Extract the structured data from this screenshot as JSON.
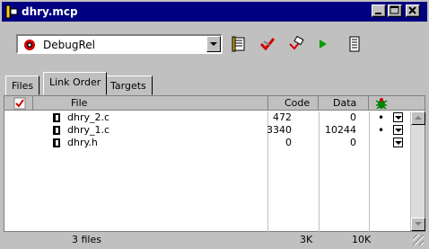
{
  "window": {
    "title": "dhry.mcp"
  },
  "toolbar": {
    "target": "DebugRel",
    "buttons": [
      "make-icon",
      "check-icon",
      "check-edit-icon",
      "run-icon",
      "settings-icon"
    ]
  },
  "tabs": [
    {
      "label": "Files",
      "active": false
    },
    {
      "label": "Link Order",
      "active": true
    },
    {
      "label": "Targets",
      "active": false
    }
  ],
  "table": {
    "headers": {
      "file": "File",
      "code": "Code",
      "data": "Data"
    },
    "rows": [
      {
        "name": "dhry_2.c",
        "code": "472",
        "data": "0",
        "dot": "•"
      },
      {
        "name": "dhry_1.c",
        "code": "3340",
        "data": "10244",
        "dot": "•"
      },
      {
        "name": "dhry.h",
        "code": "0",
        "data": "0",
        "dot": ""
      }
    ]
  },
  "status": {
    "files": "3 files",
    "code_total": "3K",
    "data_total": "10K"
  },
  "colors": {
    "titlebar": "#000080",
    "face": "#c0c0c0",
    "accent_red": "#d20000",
    "accent_green": "#008000"
  }
}
